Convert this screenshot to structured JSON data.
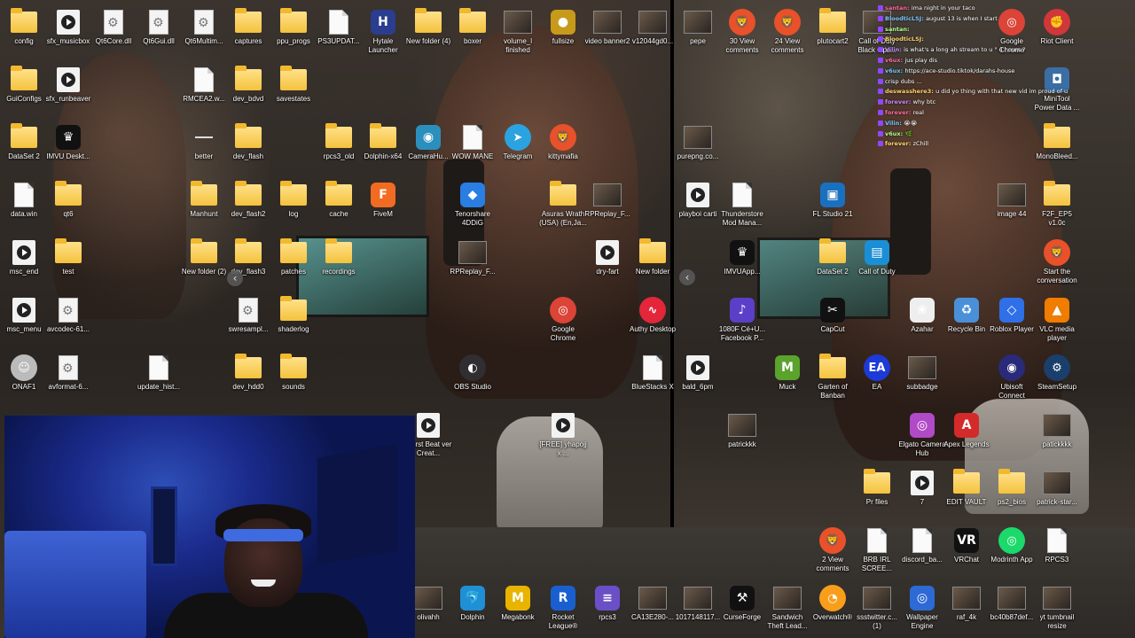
{
  "left_panel_icons": [
    {
      "label": "config",
      "type": "folder"
    },
    {
      "label": "sfx_musicbox",
      "type": "video"
    },
    {
      "label": "Qt6Core.dll",
      "type": "dll"
    },
    {
      "label": "Qt6Gui.dll",
      "type": "dll"
    },
    {
      "label": "Qt6Multim...",
      "type": "dll"
    },
    {
      "label": "captures",
      "type": "folder"
    },
    {
      "label": "ppu_progs",
      "type": "folder"
    },
    {
      "label": "PS3UPDAT...",
      "type": "file"
    },
    {
      "label": "Hytale Launcher",
      "type": "app",
      "color": "#2a3d8f",
      "glyph": "H"
    },
    {
      "label": "New folder (4)",
      "type": "folder"
    },
    {
      "label": "boxer",
      "type": "folder"
    },
    {
      "label": "volume_l finished",
      "type": "thumb"
    },
    {
      "label": "fullsize",
      "type": "app",
      "color": "#c89a1a",
      "glyph": "●"
    },
    {
      "label": "video banner2",
      "type": "thumb"
    },
    {
      "label": "v12044gd0...",
      "type": "thumb"
    },
    {
      "label": "GuiConfigs",
      "type": "folder"
    },
    {
      "label": "sfx_runbeaver",
      "type": "video"
    },
    {
      "label": "RMCEA2.w...",
      "type": "file"
    },
    {
      "label": "dev_bdvd",
      "type": "folder"
    },
    {
      "label": "savestates",
      "type": "folder"
    },
    {
      "label": "DataSet 2",
      "type": "folder"
    },
    {
      "label": "IMVU Deskt...",
      "type": "app",
      "color": "#111",
      "glyph": "♛"
    },
    {
      "label": "better",
      "type": "none"
    },
    {
      "label": "dev_flash",
      "type": "folder"
    },
    {
      "label": "rpcs3_old",
      "type": "folder"
    },
    {
      "label": "Dolphin-x64",
      "type": "folder"
    },
    {
      "label": "CameraHu...",
      "type": "app",
      "color": "#2b8fbd",
      "glyph": "◉"
    },
    {
      "label": "WOW MANE",
      "type": "file"
    },
    {
      "label": "Telegram",
      "type": "round",
      "color": "#2aa3e0",
      "glyph": "➤"
    },
    {
      "label": "kittymafia",
      "type": "round",
      "color": "#e8512a",
      "glyph": "🦁"
    },
    {
      "label": "data.win",
      "type": "file"
    },
    {
      "label": "qt6",
      "type": "folder"
    },
    {
      "label": "Manhunt",
      "type": "folder"
    },
    {
      "label": "dev_flash2",
      "type": "folder"
    },
    {
      "label": "log",
      "type": "folder"
    },
    {
      "label": "cache",
      "type": "folder"
    },
    {
      "label": "FiveM",
      "type": "app",
      "color": "#f26b22",
      "glyph": "F"
    },
    {
      "label": "Tenorshare 4DDiG",
      "type": "app",
      "color": "#2a7de1",
      "glyph": "◆"
    },
    {
      "label": "Asuras Wrath (USA) (En,Ja...",
      "type": "folder"
    },
    {
      "label": "RPReplay_F...",
      "type": "thumb"
    },
    {
      "label": "msc_end",
      "type": "video"
    },
    {
      "label": "test",
      "type": "folder"
    },
    {
      "label": "New folder (2)",
      "type": "folder"
    },
    {
      "label": "dev_flash3",
      "type": "folder"
    },
    {
      "label": "patches",
      "type": "folder"
    },
    {
      "label": "recordings",
      "type": "folder"
    },
    {
      "label": "RPReplay_F...",
      "type": "thumb"
    },
    {
      "label": "dry-fart",
      "type": "video"
    },
    {
      "label": "New folder",
      "type": "folder"
    },
    {
      "label": "msc_menu",
      "type": "video"
    },
    {
      "label": "avcodec-61...",
      "type": "dll"
    },
    {
      "label": "swresampl...",
      "type": "dll"
    },
    {
      "label": "shaderlog",
      "type": "folder"
    },
    {
      "label": "Google Chrome",
      "type": "round",
      "color": "#db4437",
      "glyph": "◎"
    },
    {
      "label": "Authy Desktop",
      "type": "round",
      "color": "#e3263a",
      "glyph": "∿"
    },
    {
      "label": "ONAF1",
      "type": "round",
      "color": "#bbb",
      "glyph": "☺"
    },
    {
      "label": "avformat-6...",
      "type": "dll"
    },
    {
      "label": "update_hist...",
      "type": "file"
    },
    {
      "label": "dev_hdd0",
      "type": "folder"
    },
    {
      "label": "sounds",
      "type": "folder"
    },
    {
      "label": "OBS Studio",
      "type": "round",
      "color": "#302e31",
      "glyph": "◐"
    },
    {
      "label": "BlueStacks X",
      "type": "file"
    },
    {
      "label": "Worst Beat ver Creat...",
      "type": "video"
    },
    {
      "label": "[FREE] yhapojj x ...",
      "type": "video"
    },
    {
      "label": "olivahh",
      "type": "thumb"
    },
    {
      "label": "Dolphin",
      "type": "app",
      "color": "#1f8fd6",
      "glyph": "🐬"
    },
    {
      "label": "Megabonk",
      "type": "app",
      "color": "#e8b400",
      "glyph": "M"
    },
    {
      "label": "Rocket League®",
      "type": "app",
      "color": "#1a5fd0",
      "glyph": "R"
    },
    {
      "label": "rpcs3",
      "type": "app",
      "color": "#6b4fc7",
      "glyph": "≡"
    },
    {
      "label": "CA13E280-...",
      "type": "thumb"
    }
  ],
  "right_panel_icons": [
    {
      "label": "pepe",
      "type": "thumb"
    },
    {
      "label": "30 View comments",
      "type": "round",
      "color": "#e8512a",
      "glyph": "🦁"
    },
    {
      "label": "24 View comments",
      "type": "round",
      "color": "#e8512a",
      "glyph": "🦁"
    },
    {
      "label": "plutocart2",
      "type": "folder"
    },
    {
      "label": "Call of Duty Black Ops...",
      "type": "thumb"
    },
    {
      "label": "Google Chrome",
      "type": "round",
      "color": "#db4437",
      "glyph": "◎"
    },
    {
      "label": "Riot Client",
      "type": "round",
      "color": "#d13639",
      "glyph": "✊"
    },
    {
      "label": "purepng.co...",
      "type": "thumb"
    },
    {
      "label": "MiniTool Power Data ...",
      "type": "app",
      "color": "#3a6ea5",
      "glyph": "◘"
    },
    {
      "label": "MonoBleed...",
      "type": "folder"
    },
    {
      "label": "playboi carti",
      "type": "video"
    },
    {
      "label": "Thunderstore Mod Mana...",
      "type": "file"
    },
    {
      "label": "FL Studio 21",
      "type": "app",
      "color": "#1b6fbf",
      "glyph": "▣"
    },
    {
      "label": "image 44",
      "type": "thumb"
    },
    {
      "label": "F2F_EP5 v1.0c",
      "type": "folder"
    },
    {
      "label": "IMVUApp...",
      "type": "app",
      "color": "#111",
      "glyph": "♛"
    },
    {
      "label": "DataSet 2",
      "type": "folder"
    },
    {
      "label": "Call of Duty",
      "type": "app",
      "color": "#1b8fd6",
      "glyph": "▤"
    },
    {
      "label": "Start the conversation",
      "type": "round",
      "color": "#e8512a",
      "glyph": "🦁"
    },
    {
      "label": "1080F Cé+U... Facebook P...",
      "type": "app",
      "color": "#5b3fc9",
      "glyph": "♪"
    },
    {
      "label": "CapCut",
      "type": "app",
      "color": "#111",
      "glyph": "✂"
    },
    {
      "label": "Azahar",
      "type": "app",
      "color": "#eee",
      "glyph": "❀"
    },
    {
      "label": "Recycle Bin",
      "type": "app",
      "color": "#4a90d9",
      "glyph": "♻"
    },
    {
      "label": "Roblox Player",
      "type": "app",
      "color": "#2f6fe8",
      "glyph": "◇"
    },
    {
      "label": "VLC media player",
      "type": "app",
      "color": "#f07c00",
      "glyph": "▲"
    },
    {
      "label": "bald_6pm",
      "type": "video"
    },
    {
      "label": "Muck",
      "type": "app",
      "color": "#5aa32c",
      "glyph": "M"
    },
    {
      "label": "Garten of Banban",
      "type": "folder"
    },
    {
      "label": "EA",
      "type": "round",
      "color": "#1c3ad8",
      "glyph": "EA"
    },
    {
      "label": "subbadge",
      "type": "thumb"
    },
    {
      "label": "Ubisoft Connect",
      "type": "round",
      "color": "#2a2a7a",
      "glyph": "◉"
    },
    {
      "label": "SteamSetup",
      "type": "round",
      "color": "#1a3f6b",
      "glyph": "⚙"
    },
    {
      "label": "patrickkk",
      "type": "thumb"
    },
    {
      "label": "Elgato Camera Hub",
      "type": "app",
      "color": "#b14ac6",
      "glyph": "◎"
    },
    {
      "label": "Apex Legends",
      "type": "app",
      "color": "#d42a2a",
      "glyph": "A"
    },
    {
      "label": "patickkkk",
      "type": "thumb"
    },
    {
      "label": "Pr files",
      "type": "folder"
    },
    {
      "label": "7",
      "type": "video"
    },
    {
      "label": "EDIT VAULT",
      "type": "folder"
    },
    {
      "label": "ps2_bios",
      "type": "folder"
    },
    {
      "label": "patrick-star...",
      "type": "thumb"
    },
    {
      "label": "2 View comments",
      "type": "round",
      "color": "#e8512a",
      "glyph": "🦁"
    },
    {
      "label": "BRB IRL SCREE...",
      "type": "file"
    },
    {
      "label": "discord_ba...",
      "type": "file"
    },
    {
      "label": "VRChat",
      "type": "app",
      "color": "#111",
      "glyph": "VR"
    },
    {
      "label": "Modrinth App",
      "type": "round",
      "color": "#1bd96a",
      "glyph": "◎"
    },
    {
      "label": "RPCS3",
      "type": "file"
    },
    {
      "label": "1017148117...",
      "type": "thumb"
    },
    {
      "label": "CurseForge",
      "type": "app",
      "color": "#111",
      "glyph": "⚒"
    },
    {
      "label": "Sandwich Theft Lead...",
      "type": "thumb"
    },
    {
      "label": "Overwatch®",
      "type": "round",
      "color": "#f99e1a",
      "glyph": "◔"
    },
    {
      "label": "ssstwitter.c... (1)",
      "type": "thumb"
    },
    {
      "label": "Wallpaper Engine",
      "type": "app",
      "color": "#2d6ad6",
      "glyph": "◎"
    },
    {
      "label": "raf_4k",
      "type": "thumb"
    },
    {
      "label": "bc40b87def...",
      "type": "thumb"
    },
    {
      "label": "yt tumbnail resize",
      "type": "thumb"
    }
  ],
  "chat": {
    "lines": [
      {
        "user": "santan",
        "msg": "ima night in your taco"
      },
      {
        "user": "BloodticLSJ",
        "msg": "august 13 is when I start"
      },
      {
        "user": "santan",
        "msg": ""
      },
      {
        "user": "BloodticLSJ",
        "msg": ""
      },
      {
        "user": "Vilin",
        "msg": "is what's a long ah stream to u \" 4 hours ?"
      },
      {
        "user": "v6ux",
        "msg": "jus play dis"
      },
      {
        "user": "v6ux",
        "msg": "https://ace-studio.tiktok/darahs-house"
      },
      {
        "user": "",
        "msg": "crisp dubs ..."
      },
      {
        "user": "deswasshere3",
        "msg": "u did yo thing with that new vid im proud of u"
      },
      {
        "user": "forever",
        "msg": "why btc"
      },
      {
        "user": "forever",
        "msg": "real"
      },
      {
        "user": "Vilin",
        "msg": "😭😭"
      },
      {
        "user": "v6ux",
        "msg": "🌿"
      },
      {
        "user": "forever",
        "msg": "zChill"
      }
    ]
  },
  "nav": {
    "left_arrow_1": "‹",
    "left_arrow_2": "‹"
  }
}
